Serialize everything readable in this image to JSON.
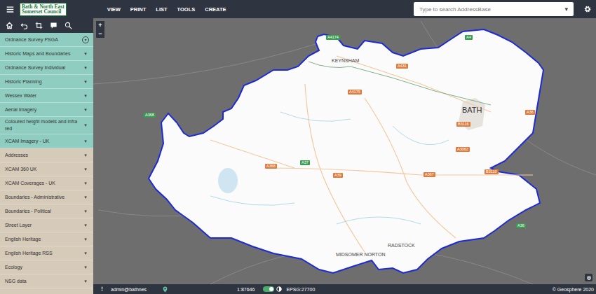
{
  "header": {
    "logo_lines": [
      "Bath & North East",
      "Somerset Council"
    ],
    "menu": [
      "VIEW",
      "PRINT",
      "LIST",
      "TOOLS",
      "CREATE"
    ],
    "search": {
      "placeholder": "Type to search AddressBase",
      "arrow": "▾"
    }
  },
  "sidebar": {
    "arrow": "▾",
    "items": [
      {
        "label": "Ordnance Survey PSGA",
        "kind": "base",
        "selected": true
      },
      {
        "label": "Historic Maps and Boundaries",
        "kind": "base",
        "selected": false
      },
      {
        "label": "Ordnance Survey Individual",
        "kind": "base",
        "selected": false
      },
      {
        "label": "Historic Planning",
        "kind": "base",
        "selected": false
      },
      {
        "label": "Wessex Water",
        "kind": "base",
        "selected": false
      },
      {
        "label": "Aerial Imagery",
        "kind": "base",
        "selected": false
      },
      {
        "label": "Coloured height models and infra red",
        "kind": "base",
        "selected": false
      },
      {
        "label": "XCAM Imagery - UK",
        "kind": "base",
        "selected": false
      },
      {
        "label": "Addresses",
        "kind": "overlay",
        "selected": false
      },
      {
        "label": "XCAM 360 UK",
        "kind": "overlay",
        "selected": false
      },
      {
        "label": "XCAM Coverages - UK",
        "kind": "overlay",
        "selected": false
      },
      {
        "label": "Boundaries - Administrative",
        "kind": "overlay",
        "selected": false
      },
      {
        "label": "Boundaries - Political",
        "kind": "overlay",
        "selected": false
      },
      {
        "label": "Street Layer",
        "kind": "overlay",
        "selected": false
      },
      {
        "label": "English Heritage",
        "kind": "overlay",
        "selected": false
      },
      {
        "label": "English Heritage RSS",
        "kind": "overlay",
        "selected": false
      },
      {
        "label": "Ecology",
        "kind": "overlay",
        "selected": false
      },
      {
        "label": "NSG data",
        "kind": "overlay",
        "selected": false
      }
    ]
  },
  "map": {
    "zoom_in": "+",
    "zoom_out": "−",
    "places": [
      "KEYNSHAM",
      "BATH",
      "RADSTOCK",
      "MIDSOMER NORTON"
    ],
    "roads": [
      {
        "label": "A4174",
        "color": "#3a9c52"
      },
      {
        "label": "A4",
        "color": "#3a9c52"
      },
      {
        "label": "A431",
        "color": "#e07b3c"
      },
      {
        "label": "A4175",
        "color": "#e07b3c"
      },
      {
        "label": "A36",
        "color": "#e07b3c"
      },
      {
        "label": "B3116",
        "color": "#e07b3c"
      },
      {
        "label": "A3062",
        "color": "#e07b3c"
      },
      {
        "label": "A368",
        "color": "#e07b3c"
      },
      {
        "label": "A37",
        "color": "#3a9c52"
      },
      {
        "label": "A39",
        "color": "#e07b3c"
      },
      {
        "label": "A367",
        "color": "#e07b3c"
      },
      {
        "label": "B3110",
        "color": "#e07b3c"
      },
      {
        "label": "A36",
        "color": "#3a9c52"
      },
      {
        "label": "A368",
        "color": "#3a9c52"
      }
    ]
  },
  "status_bar": {
    "menu": "⋮",
    "user": "admin@bathnes",
    "scale": "1:87646",
    "toggle_on": true,
    "projection": "EPSG:27700",
    "copyright": "© Geosphere 2020"
  }
}
